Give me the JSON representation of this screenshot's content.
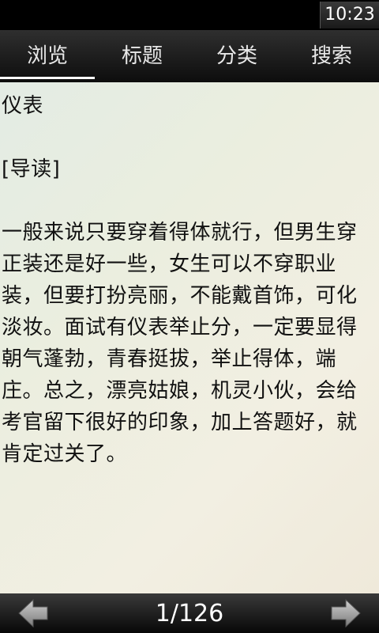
{
  "status_bar": {
    "time": "10:23"
  },
  "tabs": [
    {
      "label": "浏览",
      "active": true
    },
    {
      "label": "标题",
      "active": false
    },
    {
      "label": "分类",
      "active": false
    },
    {
      "label": "搜索",
      "active": false
    }
  ],
  "article": {
    "title": "仪表",
    "intro_label": "[导读]",
    "body": "一般来说只要穿着得体就行，但男生穿正装还是好一些，女生可以不穿职业装，但要打扮亮丽，不能戴首饰，可化淡妆。面试有仪表举止分，一定要显得朝气蓬勃，青春挺拔，举止得体，端庄。总之，漂亮姑娘，机灵小伙，会给考官留下很好的印象，加上答题好，就肯定过关了。"
  },
  "pagination": {
    "indicator": "1/126",
    "prev_icon": "left-arrow-icon",
    "next_icon": "right-arrow-icon"
  },
  "colors": {
    "bar_dark": "#111111",
    "arrow_gray": "#9a9a9a",
    "text": "#111111"
  }
}
